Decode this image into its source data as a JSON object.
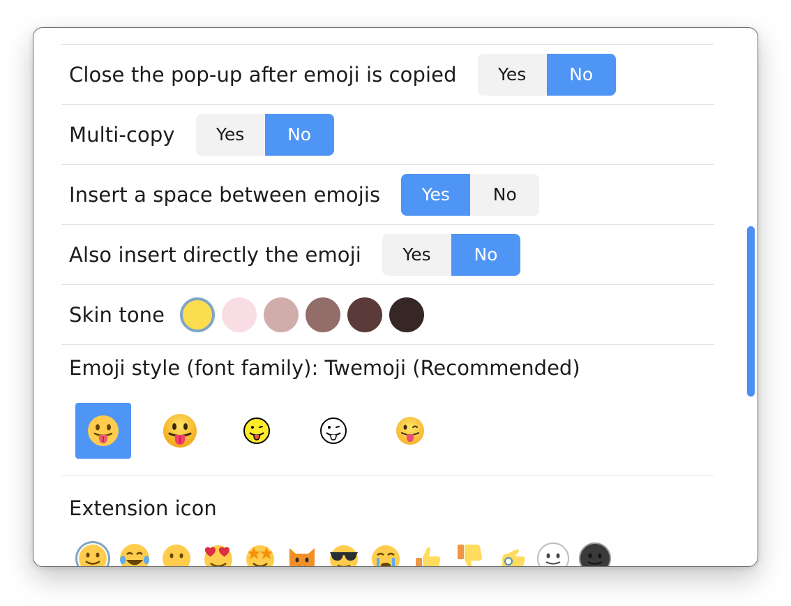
{
  "settings": {
    "close_popup": {
      "label": "Close the pop-up after emoji is copied",
      "options": [
        "Yes",
        "No"
      ],
      "selected": "No"
    },
    "multi_copy": {
      "label": "Multi-copy",
      "options": [
        "Yes",
        "No"
      ],
      "selected": "No"
    },
    "insert_space": {
      "label": "Insert a space between emojis",
      "options": [
        "Yes",
        "No"
      ],
      "selected": "Yes"
    },
    "insert_directly": {
      "label": "Also insert directly the emoji",
      "options": [
        "Yes",
        "No"
      ],
      "selected": "No"
    }
  },
  "skin_tone": {
    "label": "Skin tone",
    "tones": [
      "#fcdd4d",
      "#f9dde5",
      "#d0adaa",
      "#936d69",
      "#5b3b3a",
      "#362726"
    ],
    "selected_index": 0
  },
  "emoji_style": {
    "title": "Emoji style (font family): Twemoji (Recommended)",
    "options": [
      "twemoji",
      "apple",
      "openmoji-color",
      "openmoji-black",
      "google"
    ],
    "selected_index": 0
  },
  "extension_icon": {
    "title": "Extension icon",
    "icons": [
      "smiley-face-icon",
      "joy-face-icon",
      "neutral-face-icon",
      "heart-eyes-icon",
      "star-struck-icon",
      "cat-face-icon",
      "sunglasses-face-icon",
      "crying-face-icon",
      "thumbs-up-icon",
      "thumbs-down-icon",
      "ok-hand-icon",
      "white-face-icon",
      "dark-face-icon"
    ],
    "selected_index": 0
  },
  "colors": {
    "accent": "#4f95f5",
    "toggle_off": "#f2f2f2",
    "scrollbar": "#4a8ff2"
  }
}
